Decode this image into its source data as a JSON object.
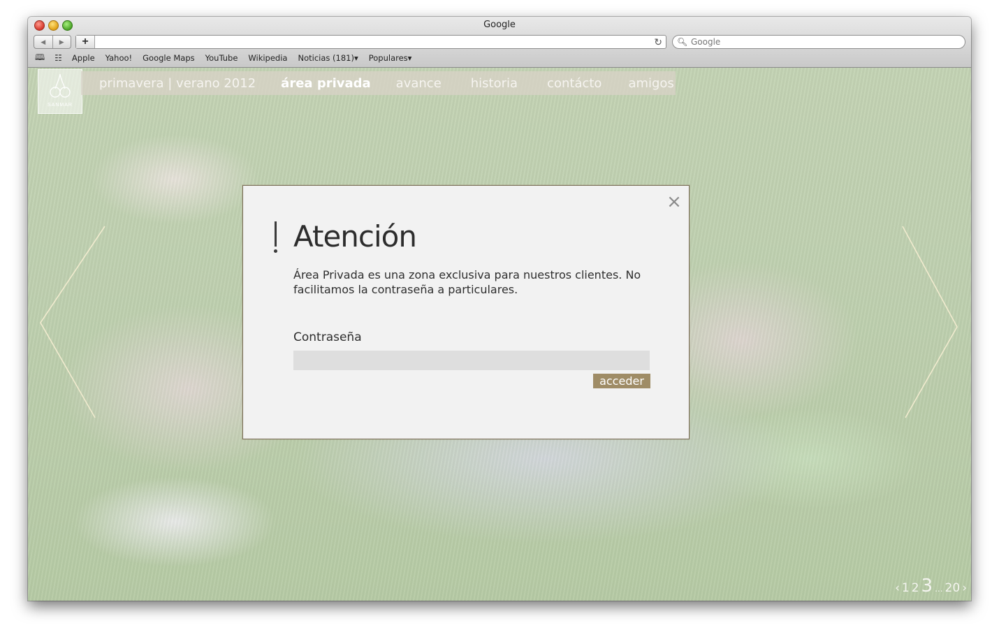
{
  "browser": {
    "window_title": "Google",
    "search_placeholder": "Google",
    "bookmarks": [
      "Apple",
      "Yahoo!",
      "Google Maps",
      "YouTube",
      "Wikipedia",
      "Noticias (181)▾",
      "Populares▾"
    ]
  },
  "site": {
    "logo_text": "SANMAR",
    "nav": [
      {
        "label": "primavera | verano 2012",
        "active": false
      },
      {
        "label": "área privada",
        "active": true
      },
      {
        "label": "avance",
        "active": false
      },
      {
        "label": "historia",
        "active": false
      },
      {
        "label": "contácto",
        "active": false
      },
      {
        "label": "amigos",
        "active": false
      }
    ],
    "pager": {
      "prev": "‹",
      "p1": "1",
      "p2": "2",
      "current": "3",
      "dots": "...",
      "last": "20",
      "next": "›"
    }
  },
  "modal": {
    "close": "×",
    "title": "Atención",
    "message": "Área Privada es una zona exclusiva para nuestros clientes. No facilitamos la contraseña a particulares.",
    "password_label": "Contraseña",
    "password_value": "",
    "submit_label": "acceder"
  },
  "colors": {
    "accent": "#9f8c66",
    "modal_bg": "#f2f2f2",
    "modal_border": "#7a6e58"
  }
}
